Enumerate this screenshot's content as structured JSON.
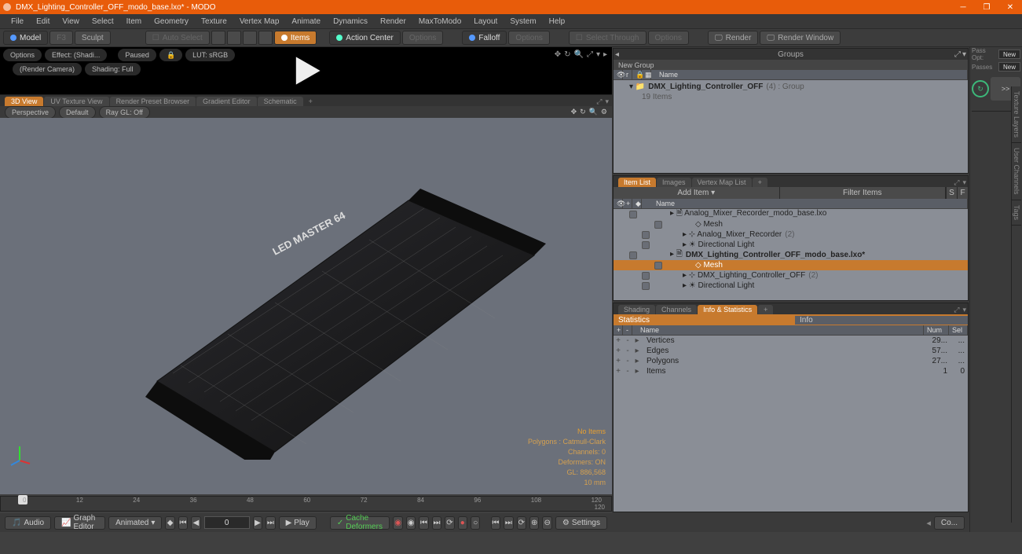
{
  "title": "DMX_Lighting_Controller_OFF_modo_base.lxo* - MODO",
  "menu": [
    "File",
    "Edit",
    "View",
    "Select",
    "Item",
    "Geometry",
    "Texture",
    "Vertex Map",
    "Animate",
    "Dynamics",
    "Render",
    "MaxToModo",
    "Layout",
    "System",
    "Help"
  ],
  "toolbar": {
    "model": "Model",
    "sculpt": "Sculpt",
    "autoselect": "Auto Select",
    "items": "Items",
    "actioncenter": "Action Center",
    "options": "Options",
    "falloff": "Falloff",
    "options2": "Options",
    "selectthrough": "Select Through",
    "options3": "Options",
    "render": "Render",
    "renderwindow": "Render Window",
    "f3": "F3"
  },
  "preview": {
    "options": "Options",
    "effect": "Effect: (Shadi...",
    "paused": "Paused",
    "lut": "LUT: sRGB",
    "rendercam": "(Render Camera)",
    "shading": "Shading: Full"
  },
  "vptabs": [
    "3D View",
    "UV Texture View",
    "Render Preset Browser",
    "Gradient Editor",
    "Schematic"
  ],
  "vpopts": {
    "persp": "Perspective",
    "def": "Default",
    "raygl": "Ray GL: Off"
  },
  "vpinfo": {
    "noitems": "No Items",
    "poly": "Polygons : Catmull-Clark",
    "chan": "Channels: 0",
    "def": "Deformers: ON",
    "gl": "GL: 886,568",
    "mm": "10 mm"
  },
  "groups": {
    "title": "Groups",
    "newgroup": "New Group",
    "name_col": "Name",
    "item": "DMX_Lighting_Controller_OFF",
    "suffix": "(4) : Group",
    "count": "19 Items"
  },
  "ilist": {
    "tabs": [
      "Item List",
      "Images",
      "Vertex Map List"
    ],
    "add": "Add Item",
    "filter": "Filter Items",
    "name_col": "Name",
    "rows": [
      {
        "t": "Analog_Mixer_Recorder_modo_base.lxo",
        "bold": false,
        "lvl": 1,
        "icon": "scene"
      },
      {
        "t": "Mesh",
        "bold": false,
        "lvl": 3,
        "icon": "mesh"
      },
      {
        "t": "Analog_Mixer_Recorder",
        "suffix": "(2)",
        "lvl": 2,
        "icon": "loc"
      },
      {
        "t": "Directional Light",
        "lvl": 2,
        "icon": "light"
      },
      {
        "t": "DMX_Lighting_Controller_OFF_modo_base.lxo*",
        "bold": true,
        "lvl": 1,
        "icon": "scene"
      },
      {
        "t": "Mesh",
        "lvl": 3,
        "icon": "mesh",
        "sel": true
      },
      {
        "t": "DMX_Lighting_Controller_OFF",
        "suffix": "(2)",
        "lvl": 2,
        "icon": "loc"
      },
      {
        "t": "Directional Light",
        "lvl": 2,
        "icon": "light"
      }
    ]
  },
  "info": {
    "tabs": [
      "Shading",
      "Channels",
      "Info & Statistics"
    ],
    "seg": {
      "stats": "Statistics",
      "info": "Info"
    },
    "cols": {
      "name": "Name",
      "num": "Num",
      "sel": "Sel"
    },
    "rows": [
      {
        "n": "Vertices",
        "num": "29...",
        "sel": "..."
      },
      {
        "n": "Edges",
        "num": "57...",
        "sel": "..."
      },
      {
        "n": "Polygons",
        "num": "27...",
        "sel": "..."
      },
      {
        "n": "Items",
        "num": "1",
        "sel": "0"
      }
    ]
  },
  "rside": {
    "passopt": "Pass Opt:",
    "new": "New",
    "passes": "Passes",
    "new2": "New",
    "arrow": ">>",
    "co": "Co..."
  },
  "timeline": {
    "marks": [
      "0",
      "12",
      "24",
      "36",
      "48",
      "60",
      "72",
      "84",
      "96",
      "108",
      "120"
    ],
    "end": "120"
  },
  "bottom": {
    "audio": "Audio",
    "graph": "Graph Editor",
    "animated": "Animated",
    "frame": "0",
    "play": "Play",
    "cache": "Cache Deformers",
    "settings": "Settings"
  },
  "sidetabs": [
    "Texture Layers",
    "User Channels",
    "Tags"
  ]
}
